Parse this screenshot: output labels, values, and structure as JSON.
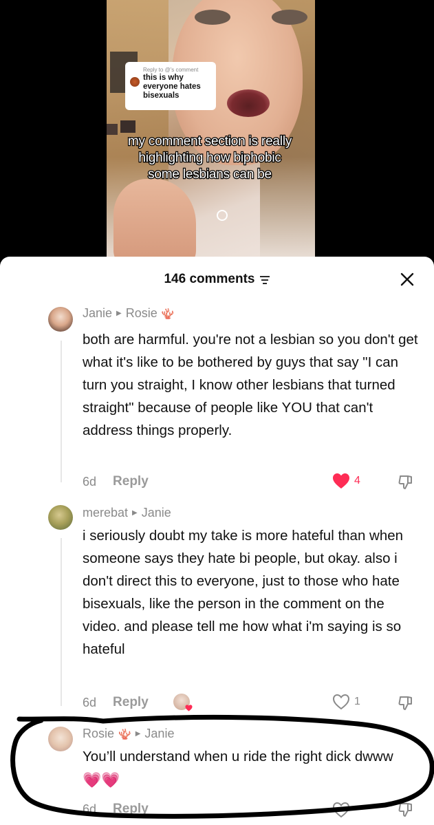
{
  "video": {
    "reply_to": "Reply to @'s comment",
    "reply_text": "this is why everyone hates bisexuals",
    "caption": "my comment section is really highlighting how biphobic some lesbians can be"
  },
  "header": {
    "comment_count": "146 comments"
  },
  "comments": [
    {
      "author": "Janie",
      "reply_to": "Rosie",
      "reply_to_badge": "🪸",
      "text": "both are harmful. you're not a lesbian so you don't get what it's like to be bothered by guys that say \"I can turn you straight, I know other lesbians that turned straight\" because of people like YOU that can't address things properly.",
      "age": "6d",
      "reply_label": "Reply",
      "likes": "4"
    },
    {
      "author": "merebat",
      "reply_to": "Janie",
      "text": "i seriously doubt my take is more hateful than when someone says they hate bi people, but okay. also i don't direct this to everyone, just to those who hate bisexuals, like the person in the comment on the video. and please tell me how what i'm saying is so hateful",
      "age": "6d",
      "reply_label": "Reply",
      "likes": "1"
    },
    {
      "author": "Rosie",
      "author_badge": "🪸",
      "reply_to": "Janie",
      "text": "You’ll understand when u ride the right dick dwww",
      "emojis": "💗💗",
      "age": "6d",
      "reply_label": "Reply"
    }
  ],
  "icons": {
    "filter": "filter-icon",
    "close": "close-icon",
    "heart": "heart-icon",
    "dislike": "thumbs-down-icon"
  },
  "colors": {
    "like_red": "#fe2c55",
    "secondary_text": "#8a8a8a",
    "text": "#111111"
  }
}
